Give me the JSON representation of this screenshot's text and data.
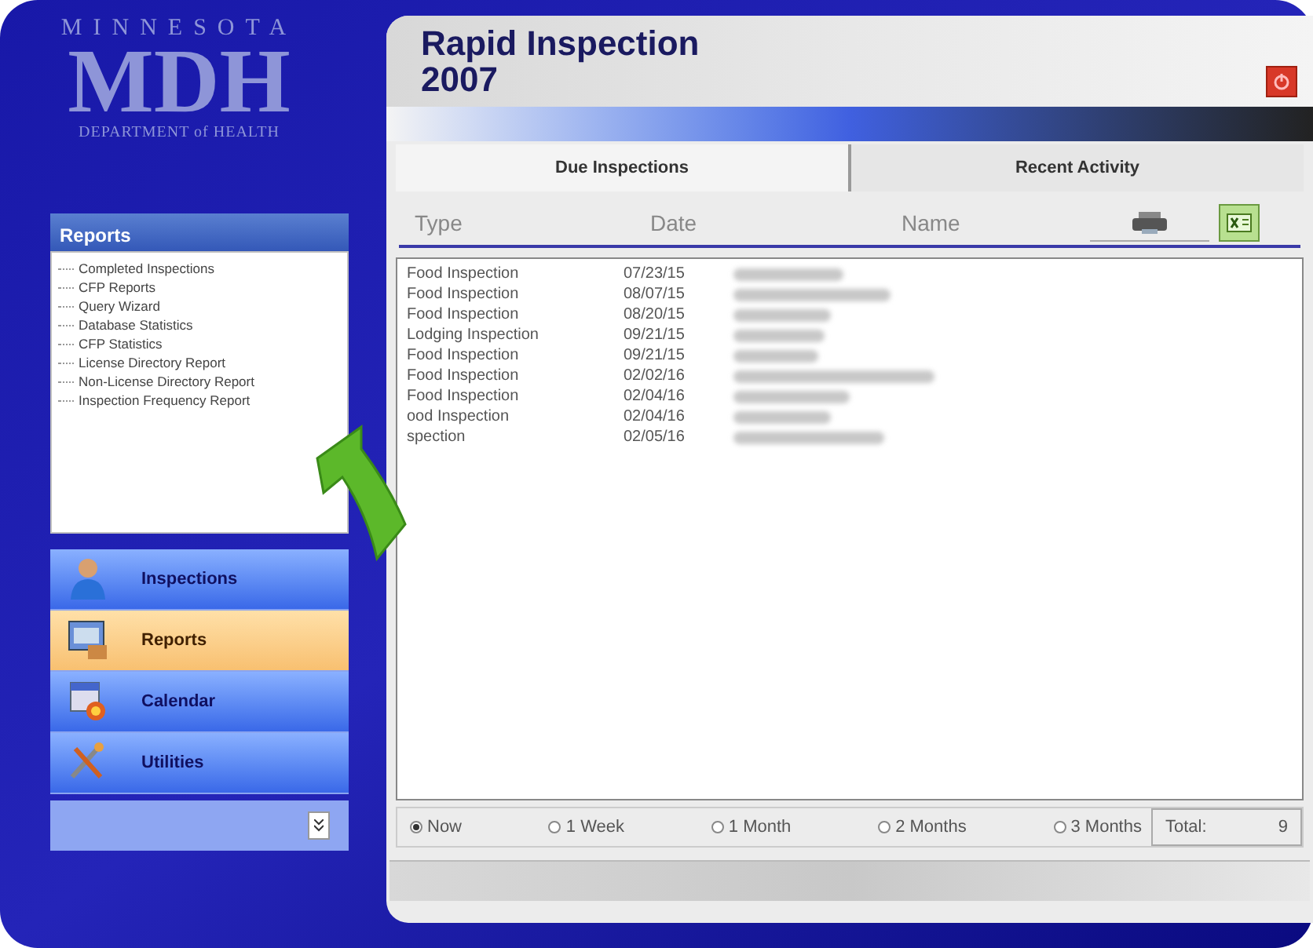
{
  "logo": {
    "top": "MINNESOTA",
    "main": "MDH",
    "bottom": "DEPARTMENT of HEALTH"
  },
  "reports_panel": {
    "title": "Reports",
    "items": [
      {
        "label": "Completed Inspections"
      },
      {
        "label": "CFP Reports"
      },
      {
        "label": "Query Wizard"
      },
      {
        "label": "Database Statistics"
      },
      {
        "label": "CFP Statistics"
      },
      {
        "label": "License Directory Report"
      },
      {
        "label": "Non-License Directory Report"
      },
      {
        "label": "Inspection Frequency Report"
      }
    ]
  },
  "nav": [
    {
      "label": "Inspections",
      "kind": "person",
      "selected": false
    },
    {
      "label": "Reports",
      "kind": "reports",
      "selected": true
    },
    {
      "label": "Calendar",
      "kind": "calendar",
      "selected": false
    },
    {
      "label": "Utilities",
      "kind": "tools",
      "selected": false
    }
  ],
  "app": {
    "title": "Rapid Inspection",
    "subtitle": "2007"
  },
  "tabs": [
    {
      "label": "Due Inspections",
      "selected": true
    },
    {
      "label": "Recent Activity",
      "selected": false
    }
  ],
  "table": {
    "columns": [
      "Type",
      "Date",
      "Name"
    ],
    "rows": [
      {
        "type": "Food Inspection",
        "date": "07/23/15"
      },
      {
        "type": "Food Inspection",
        "date": "08/07/15"
      },
      {
        "type": "Food Inspection",
        "date": "08/20/15"
      },
      {
        "type": "Lodging Inspection",
        "date": "09/21/15"
      },
      {
        "type": "Food Inspection",
        "date": "09/21/15"
      },
      {
        "type": "Food Inspection",
        "date": "02/02/16"
      },
      {
        "type": "Food Inspection",
        "date": "02/04/16"
      },
      {
        "type": "ood Inspection",
        "date": "02/04/16"
      },
      {
        "type": "spection",
        "date": "02/05/16"
      }
    ]
  },
  "ranges": [
    {
      "label": "Now",
      "selected": true
    },
    {
      "label": "1 Week",
      "selected": false
    },
    {
      "label": "1 Month",
      "selected": false
    },
    {
      "label": "2 Months",
      "selected": false
    },
    {
      "label": "3 Months",
      "selected": false
    }
  ],
  "total": {
    "label": "Total:",
    "value": "9"
  }
}
